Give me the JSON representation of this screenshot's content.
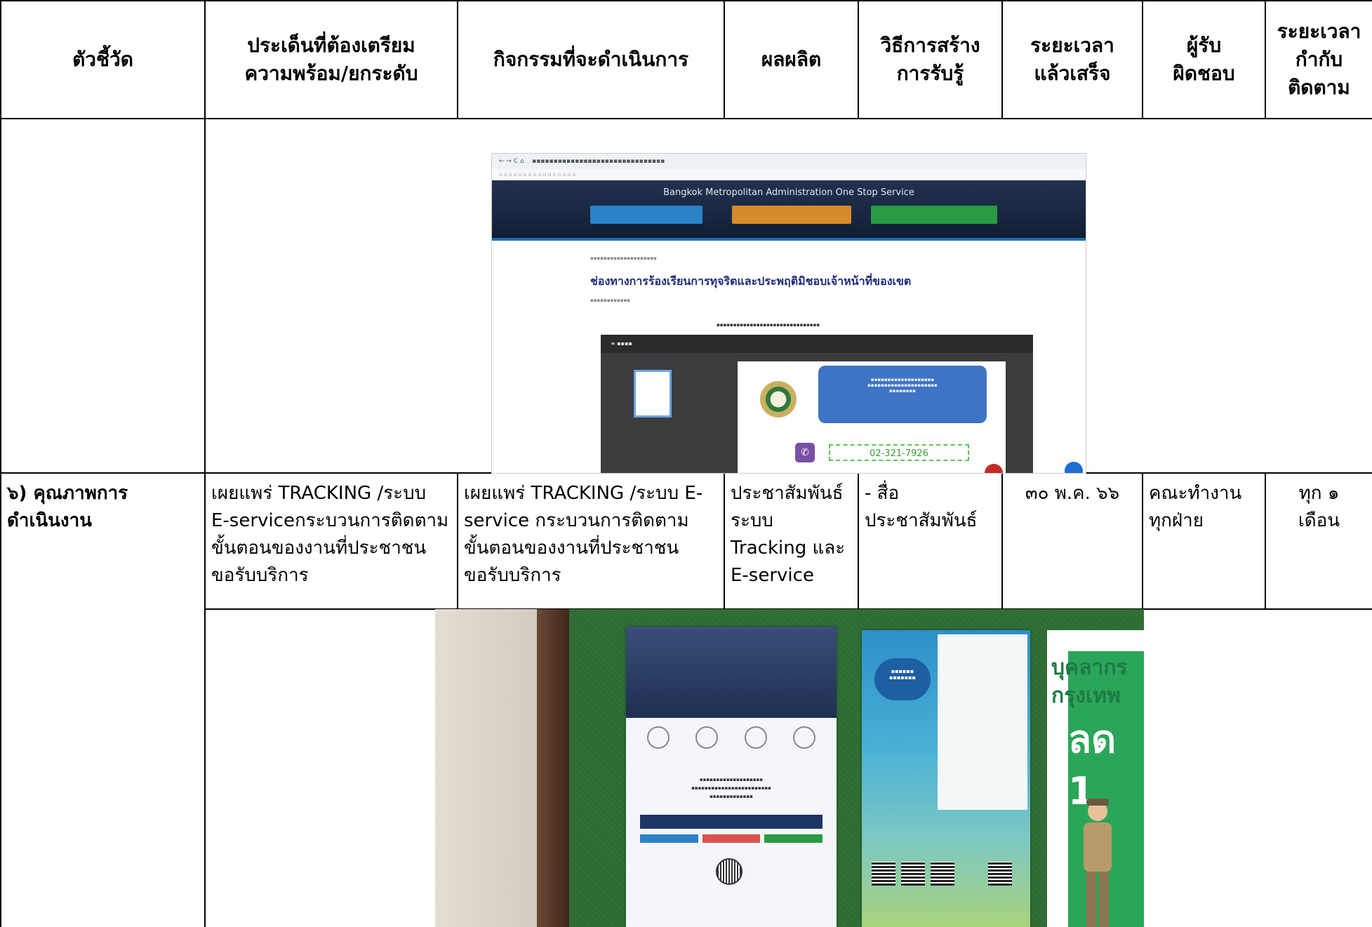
{
  "headers": [
    "ตัวชี้วัด",
    "ประเด็นที่ต้องเตรียม\nความพร้อม/ยกระดับ",
    "กิจกรรมที่จะดำเนินการ",
    "ผลผลิต",
    "วิธีการสร้าง\nการรับรู้",
    "ระยะเวลา\nแล้วเสร็จ",
    "ผู้รับ\nผิดชอบ",
    "ระยะเวลา\nกำกับ\nติดตาม"
  ],
  "screenshot_1": {
    "banner_title": "Bangkok Metropolitan Administration One Stop Service",
    "page_title": "ช่องทางการร้องเรียนการทุจริตและประพฤติมิชอบเจ้าหน้าที่ของเขต",
    "phone": "02-321-7926"
  },
  "row6": {
    "indicator_line1": "๖) คุณภาพการ",
    "indicator_line2": "ดำเนินงาน",
    "issue": [
      "เผยแพร่ TRACKING /ระบบ",
      "E-serviceกระบวนการติดตาม",
      "ขั้นตอนของงานที่ประชาชน",
      "ขอรับบริการ"
    ],
    "activity": [
      "เผยแพร่ TRACKING /ระบบ E-",
      "service กระบวนการติดตาม",
      "ขั้นตอนของงานที่ประชาชน",
      "ขอรับบริการ"
    ],
    "output": [
      "ประชาสัมพันธ์",
      "ระบบ",
      "Tracking และ",
      "E-service"
    ],
    "awareness": [
      "- สื่อ",
      "ประชาสัมพันธ์"
    ],
    "completion": "๓๐ พ.ค. ๖๖",
    "responsible": [
      "คณะทำงาน",
      "ทุกฝ่าย"
    ],
    "monitoring": [
      "ทุก ๑",
      "เดือน"
    ]
  },
  "photo_2": {
    "poster3_line1": "บุคลากร",
    "poster3_line2": "กรุงเทพ",
    "poster3_line3": "ลด 1"
  }
}
